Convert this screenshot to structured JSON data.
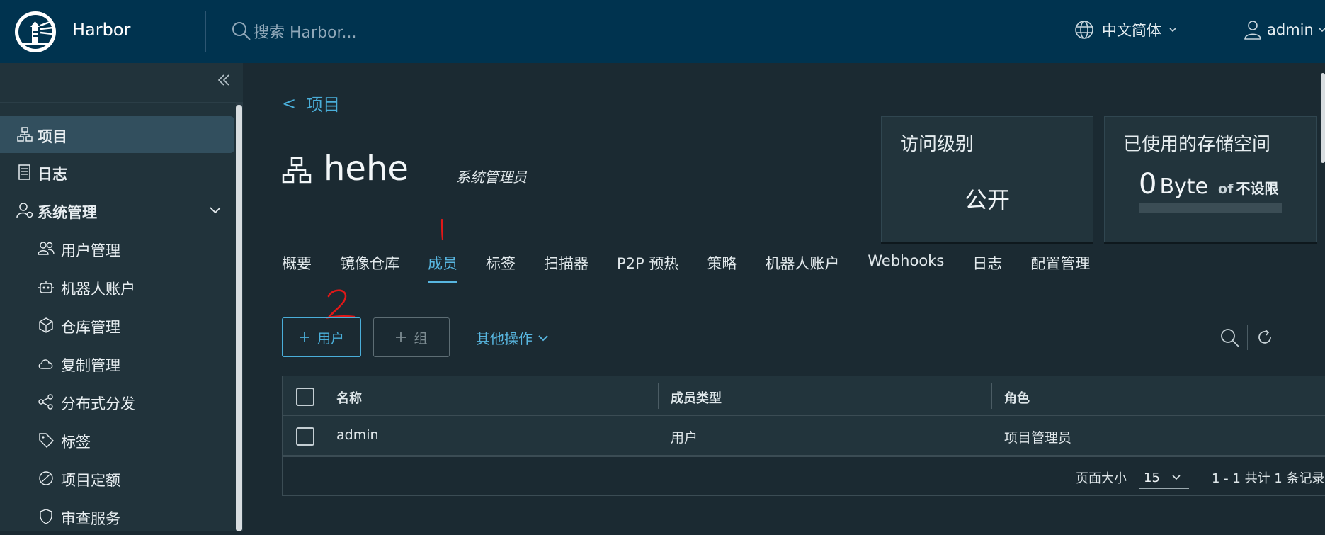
{
  "header": {
    "brand": "Harbor",
    "search_placeholder": "搜索 Harbor...",
    "language": "中文简体",
    "user": "admin"
  },
  "sidebar": {
    "items": [
      {
        "label": "项目",
        "icon": "project-icon",
        "active": true
      },
      {
        "label": "日志",
        "icon": "log-icon"
      },
      {
        "label": "系统管理",
        "icon": "admin-icon",
        "expanded": true
      },
      {
        "label": "用户管理",
        "icon": "users-icon"
      },
      {
        "label": "机器人账户",
        "icon": "robot-icon"
      },
      {
        "label": "仓库管理",
        "icon": "box-icon"
      },
      {
        "label": "复制管理",
        "icon": "cloud-icon"
      },
      {
        "label": "分布式分发",
        "icon": "share-icon"
      },
      {
        "label": "标签",
        "icon": "tag-icon"
      },
      {
        "label": "项目定额",
        "icon": "quota-icon"
      },
      {
        "label": "审查服务",
        "icon": "shield-icon"
      }
    ]
  },
  "breadcrumb": {
    "arrow": "<",
    "label": "项目"
  },
  "project": {
    "name": "hehe",
    "role": "系统管理员"
  },
  "cards": {
    "access": {
      "title": "访问级别",
      "value": "公开"
    },
    "storage": {
      "title": "已使用的存储空间",
      "amount": "0",
      "unit": "Byte",
      "of": "of",
      "limit": "不设限"
    }
  },
  "tabs": [
    "概要",
    "镜像仓库",
    "成员",
    "标签",
    "扫描器",
    "P2P 预热",
    "策略",
    "机器人账户",
    "Webhooks",
    "日志",
    "配置管理"
  ],
  "active_tab": "成员",
  "annotations": {
    "one": "1",
    "two": "2"
  },
  "toolbar": {
    "add_user": "用户",
    "add_group": "组",
    "other_ops": "其他操作"
  },
  "table": {
    "columns": [
      "名称",
      "成员类型",
      "角色"
    ],
    "rows": [
      [
        "admin",
        "用户",
        "项目管理员"
      ]
    ],
    "page_size_label": "页面大小",
    "page_size": "15",
    "page_info": "1 - 1 共计 1 条记录"
  },
  "colors": {
    "header_bg": "#00334f",
    "accent": "#58b6e0",
    "annotation": "#e01818"
  }
}
